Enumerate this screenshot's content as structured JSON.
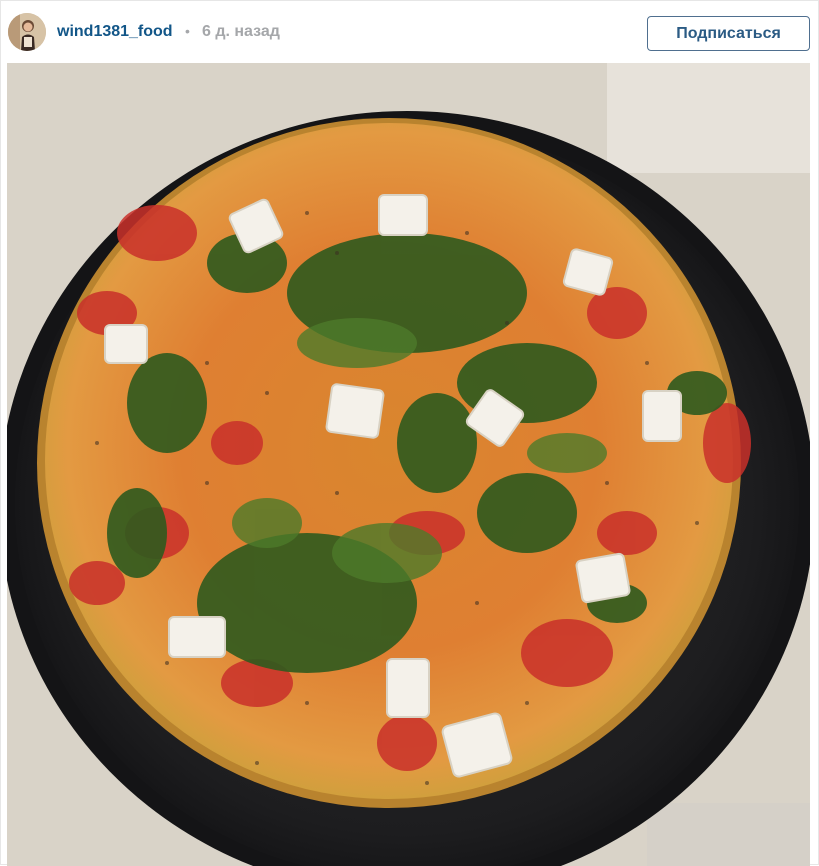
{
  "header": {
    "username": "wind1381_food",
    "separator": "•",
    "timestamp": "6 д. назад",
    "follow_label": "Подписаться"
  },
  "icons": {
    "avatar": "profile-avatar"
  },
  "colors": {
    "username": "#125688",
    "timestamp": "#a5a7aa",
    "follow_border": "#4f6f8f"
  }
}
